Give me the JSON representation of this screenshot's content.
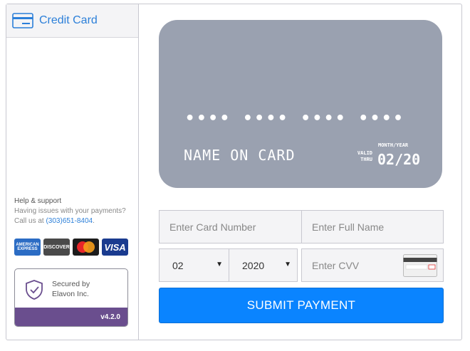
{
  "tab": {
    "label": "Credit Card",
    "icon": "credit-card-icon"
  },
  "support": {
    "title": "Help & support",
    "text_line1": "Having issues with your payments?",
    "text_prefix": "Call us at",
    "phone": "(303)651-8404",
    "phone_suffix": "."
  },
  "brands": {
    "amex_line1": "AMERICAN",
    "amex_line2": "EXPRESS",
    "discover": "DISCOVER",
    "visa": "VISA"
  },
  "secure": {
    "line1": "Secured by",
    "line2": "Elavon Inc.",
    "version": "v4.2.0",
    "icon": "shield-check-icon"
  },
  "card": {
    "number_mask": "•••• •••• •••• ••••",
    "name": "NAME ON CARD",
    "valid_line1": "VALID",
    "valid_line2": "THRU",
    "month_year_label": "MONTH/YEAR",
    "expiry": "02/20"
  },
  "form": {
    "card_number_placeholder": "Enter Card Number",
    "full_name_placeholder": "Enter Full Name",
    "month": "02",
    "year": "2020",
    "cvv_placeholder": "Enter CVV",
    "submit_label": "SUBMIT PAYMENT"
  },
  "colors": {
    "accent": "#0a84ff",
    "link": "#2b7fd9",
    "card_bg": "#9aa1b0",
    "version_bar": "#6a4e8e"
  }
}
